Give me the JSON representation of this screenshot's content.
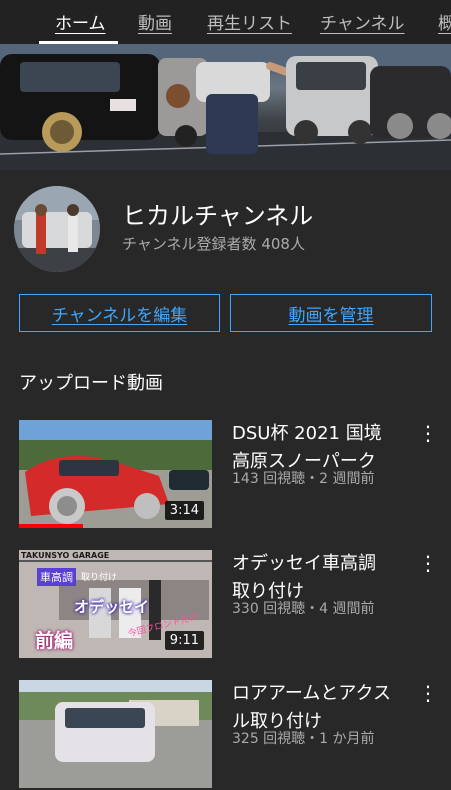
{
  "tabs": [
    {
      "label": "ホーム",
      "active": true
    },
    {
      "label": "動画",
      "active": false
    },
    {
      "label": "再生リスト",
      "active": false
    },
    {
      "label": "チャンネル",
      "active": false
    },
    {
      "label": "概",
      "active": false
    }
  ],
  "channel": {
    "name": "ヒカルチャンネル",
    "subscribers": "チャンネル登録者数 408人"
  },
  "buttons": {
    "edit_channel": "チャンネルを編集",
    "manage_videos": "動画を管理"
  },
  "section_title": "アップロード動画",
  "videos": [
    {
      "title": "DSU杯 2021 国境高原スノーパーク",
      "meta": "143 回視聴・2 週間前",
      "duration": "3:14",
      "watched_fraction": 0.33
    },
    {
      "title": "オデッセイ車高調取り付け",
      "meta": "330 回視聴・4 週間前",
      "duration": "9:11",
      "watched_fraction": 0,
      "thumb_text": {
        "brand": "TAKUNSYO GARAGE",
        "tag": "車高調",
        "tag_sub": "取り付け",
        "main": "オデッセイ",
        "part": "前編",
        "note": "今回フロントだけ"
      }
    },
    {
      "title": "ロアアームとアクスル取り付け",
      "meta": "325 回視聴・1 か月前",
      "duration": "",
      "watched_fraction": 0
    }
  ],
  "colors": {
    "background": "#282828",
    "accent_blue": "#3ea6ff",
    "progress_red": "#ff0000",
    "secondary_text": "#aaaaaa"
  },
  "icons": {
    "kebab": "more-vert-icon"
  }
}
